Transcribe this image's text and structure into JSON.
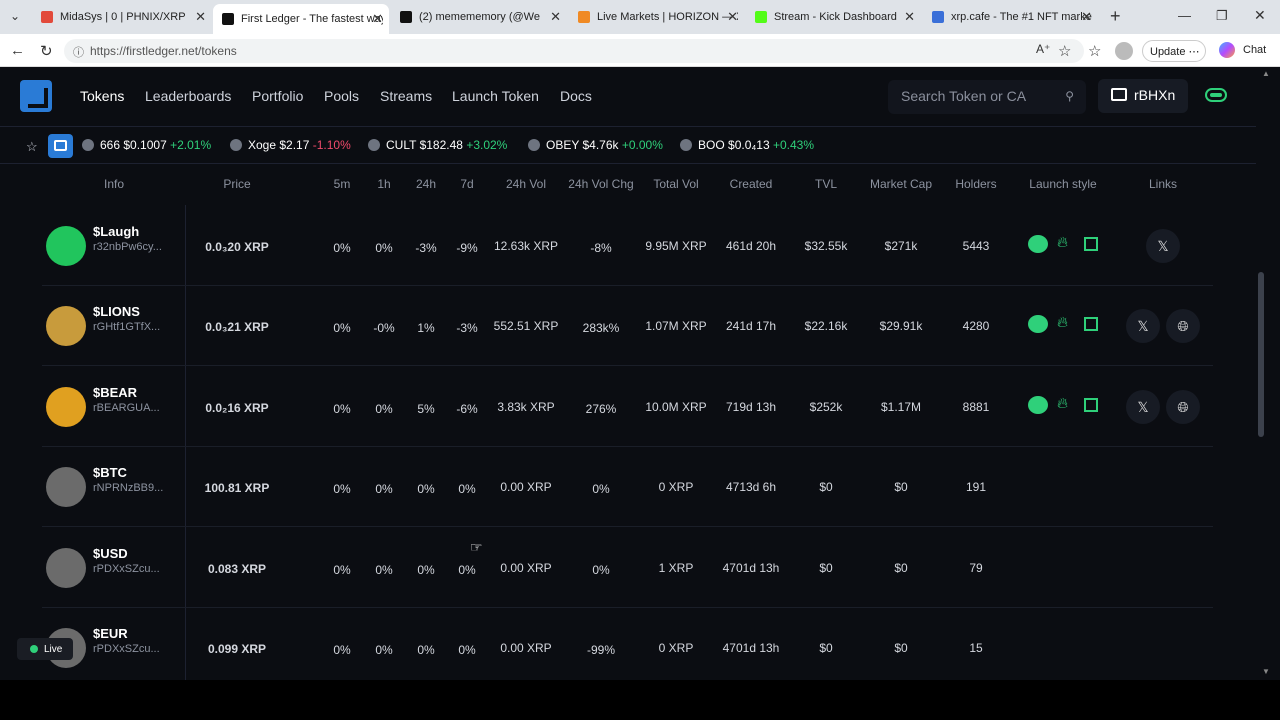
{
  "browser": {
    "tabs": [
      {
        "title": "MidaSys | 0 | PHNIX/XRP",
        "color": "#e24a3b"
      },
      {
        "title": "First Ledger - The fastest way",
        "color": "#111"
      },
      {
        "title": "(2) memememory (@We",
        "color": "#111"
      },
      {
        "title": "Live Markets | HORIZON — X",
        "color": "#f08a24"
      },
      {
        "title": "Stream - Kick Dashboard",
        "color": "#53fc18"
      },
      {
        "title": "xrp.cafe - The #1 NFT market",
        "color": "#3a6fd8"
      }
    ],
    "url": "https://firstledger.net/tokens",
    "update_label": "Update",
    "chat_label": "Chat"
  },
  "nav": {
    "items": [
      "Tokens",
      "Leaderboards",
      "Portfolio",
      "Pools",
      "Streams",
      "Launch Token",
      "Docs"
    ],
    "search_placeholder": "Search Token or CA",
    "wallet": "rBHXn"
  },
  "ticker": [
    {
      "name": "666",
      "price": "$0.1007",
      "change": "+2.01%"
    },
    {
      "name": "Xoge",
      "price": "$2.17",
      "change": "-1.10%"
    },
    {
      "name": "CULT",
      "price": "$182.48",
      "change": "+3.02%"
    },
    {
      "name": "OBEY",
      "price": "$4.76k",
      "change": "+0.00%"
    },
    {
      "name": "BOO",
      "price": "$0.0₄13",
      "change": "+0.43%"
    }
  ],
  "table": {
    "headers": [
      "Info",
      "Price",
      "5m",
      "1h",
      "24h",
      "7d",
      "24h Vol",
      "24h Vol Chg",
      "Total Vol",
      "Created",
      "TVL",
      "Market Cap",
      "Holders",
      "Launch style",
      "Links"
    ],
    "rows": [
      {
        "name": "$Laugh",
        "addr": "r32nbPw6cy...",
        "price": "0.0₃20 XRP",
        "m5": "0%",
        "h1": "0%",
        "h24": "-3%",
        "d7": "-9%",
        "vol": "12.63k XRP",
        "volchg": "-8%",
        "total": "9.95M XRP",
        "created": "461d 20h",
        "tvl": "$32.55k",
        "mcap": "$271k",
        "holders": "5443",
        "avatar": "#21c55d",
        "launch": true,
        "links": [
          "X"
        ]
      },
      {
        "name": "$LIONS",
        "addr": "rGHtf1GTfX...",
        "price": "0.0₃21 XRP",
        "m5": "0%",
        "h1": "-0%",
        "h24": "1%",
        "d7": "-3%",
        "vol": "552.51 XRP",
        "volchg": "283k%",
        "total": "1.07M XRP",
        "created": "241d 17h",
        "tvl": "$22.16k",
        "mcap": "$29.91k",
        "holders": "4280",
        "avatar": "#c89b3c",
        "launch": true,
        "links": [
          "X",
          "web"
        ]
      },
      {
        "name": "$BEAR",
        "addr": "rBEARGUA...",
        "price": "0.0₂16 XRP",
        "m5": "0%",
        "h1": "0%",
        "h24": "5%",
        "d7": "-6%",
        "vol": "3.83k XRP",
        "volchg": "276%",
        "total": "10.0M XRP",
        "created": "719d 13h",
        "tvl": "$252k",
        "mcap": "$1.17M",
        "holders": "8881",
        "avatar": "#e0a020",
        "launch": true,
        "links": [
          "X",
          "web"
        ]
      },
      {
        "name": "$BTC",
        "addr": "rNPRNzBB9...",
        "price": "100.81 XRP",
        "m5": "0%",
        "h1": "0%",
        "h24": "0%",
        "d7": "0%",
        "vol": "0.00 XRP",
        "volchg": "0%",
        "total": "0 XRP",
        "created": "4713d 6h",
        "tvl": "$0",
        "mcap": "$0",
        "holders": "191",
        "avatar": "#6b6b6b",
        "launch": false,
        "links": []
      },
      {
        "name": "$USD",
        "addr": "rPDXxSZcu...",
        "price": "0.083 XRP",
        "m5": "0%",
        "h1": "0%",
        "h24": "0%",
        "d7": "0%",
        "vol": "0.00 XRP",
        "volchg": "0%",
        "total": "1 XRP",
        "created": "4701d 13h",
        "tvl": "$0",
        "mcap": "$0",
        "holders": "79",
        "avatar": "#6b6b6b",
        "launch": false,
        "links": []
      },
      {
        "name": "$EUR",
        "addr": "rPDXxSZcu...",
        "price": "0.099 XRP",
        "m5": "0%",
        "h1": "0%",
        "h24": "0%",
        "d7": "0%",
        "vol": "0.00 XRP",
        "volchg": "-99%",
        "total": "0 XRP",
        "created": "4701d 13h",
        "tvl": "$0",
        "mcap": "$0",
        "holders": "15",
        "avatar": "#6b6b6b",
        "launch": false,
        "links": []
      }
    ]
  },
  "live_label": "Live",
  "colors": {
    "positive": "#2fd07a",
    "negative": "#f04a6b",
    "accent": "#2a7bd6"
  }
}
